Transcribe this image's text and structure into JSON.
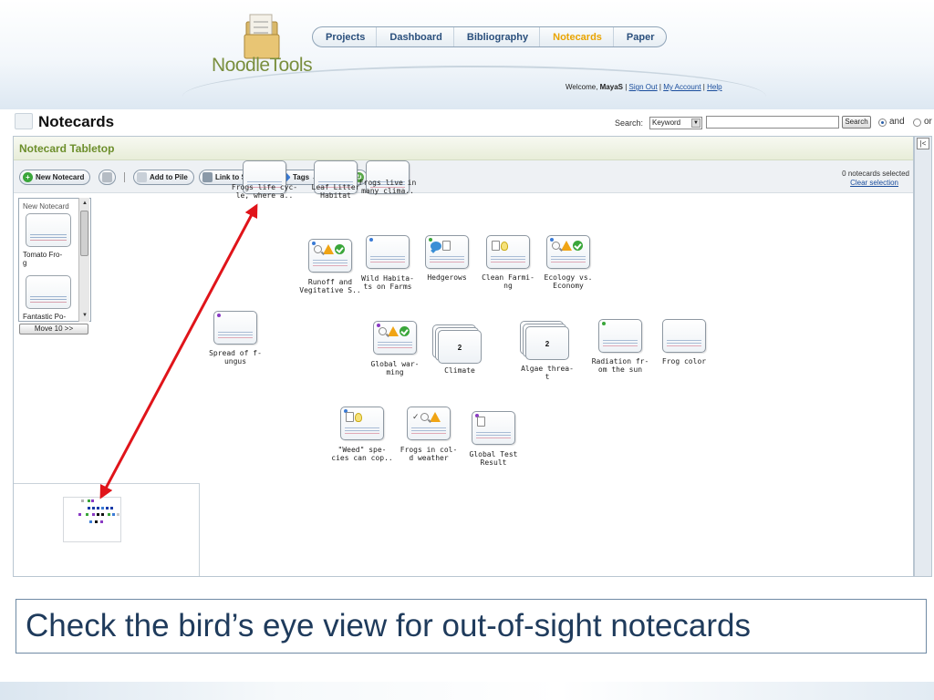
{
  "app": {
    "logo_text": "NoodleTools",
    "nav": [
      {
        "label": "Projects",
        "active": false
      },
      {
        "label": "Dashboard",
        "active": false
      },
      {
        "label": "Bibliography",
        "active": false
      },
      {
        "label": "Notecards",
        "active": true
      },
      {
        "label": "Paper",
        "active": false
      }
    ],
    "welcome_prefix": "Welcome, ",
    "username": "MayaS",
    "links": [
      "Sign Out",
      "My Account",
      "Help"
    ],
    "sep": " | "
  },
  "page": {
    "title": "Notecards",
    "search_label": "Search:",
    "search_type": "Keyword",
    "search_value": "",
    "search_button": "Search",
    "radio_and": "and",
    "radio_or": "or"
  },
  "panel": {
    "title": "Notecard Tabletop",
    "collapse_glyph": "|<",
    "toolbar": {
      "new_notecard": "New Notecard",
      "add_to_pile": "Add to Pile",
      "link_to_source": "Link to Source",
      "tags": "Tags",
      "selected_count": "0 notecards selected",
      "clear_selection": "Clear selection"
    },
    "pile": {
      "header": "New Notecard",
      "items": [
        "Tomato Fro-\ng",
        "Fantastic Po-"
      ],
      "move_button": "Move 10 >>"
    }
  },
  "notecards": [
    {
      "label": "Frogs life cyc-\nle, where a..",
      "tag": "",
      "icons": [],
      "stack": 0
    },
    {
      "label": "Leaf Litter\nHabitat",
      "tag": "",
      "icons": [],
      "stack": 0
    },
    {
      "label": "Frogs live in\nmany clima..",
      "tag": "",
      "icons": [],
      "stack": 0
    },
    {
      "label": "Runoff and\nVegitative S..",
      "tag": "#3a7bd5",
      "icons": [
        "mag",
        "warn",
        "ok"
      ],
      "stack": 0
    },
    {
      "label": "Wild Habita-\nts on Farms",
      "tag": "#3a7bd5",
      "icons": [],
      "stack": 0
    },
    {
      "label": "Hedgerows",
      "tag": "#3aa63a",
      "icons": [
        "quote",
        "doc"
      ],
      "stack": 0
    },
    {
      "label": "Clean Farmi-\nng",
      "tag": "",
      "icons": [
        "doc",
        "bulb"
      ],
      "stack": 0
    },
    {
      "label": "Ecology vs.\nEconomy",
      "tag": "#3a7bd5",
      "icons": [
        "mag",
        "warn",
        "ok"
      ],
      "stack": 0
    },
    {
      "label": "Spread of f-\nungus",
      "tag": "#8a3ac4",
      "icons": [],
      "stack": 0
    },
    {
      "label": "Global war-\nming",
      "tag": "#8a3ac4",
      "icons": [
        "mag",
        "warn",
        "ok"
      ],
      "stack": 0
    },
    {
      "label": "Climate",
      "tag": "",
      "icons": [],
      "stack": 2
    },
    {
      "label": "Algae threa-\nt",
      "tag": "",
      "icons": [],
      "stack": 2
    },
    {
      "label": "Radiation fr-\nom the sun",
      "tag": "#3aa63a",
      "icons": [],
      "stack": 0
    },
    {
      "label": "Frog color",
      "tag": "",
      "icons": [],
      "stack": 0
    },
    {
      "label": "\"Weed\" spe-\ncies can cop..",
      "tag": "#3a7bd5",
      "icons": [
        "doc",
        "bulb"
      ],
      "stack": 0
    },
    {
      "label": "Frogs in col-\nd weather",
      "tag": "",
      "icons": [
        "check",
        "mag",
        "warn"
      ],
      "stack": 0
    },
    {
      "label": "Global Test\nResult",
      "tag": "#8a3ac4",
      "icons": [
        "doc"
      ],
      "stack": 0
    }
  ],
  "annotation": {
    "caption": "Check the bird’s eye view for out-of-sight notecards",
    "arrow_color": "#e0141a"
  }
}
